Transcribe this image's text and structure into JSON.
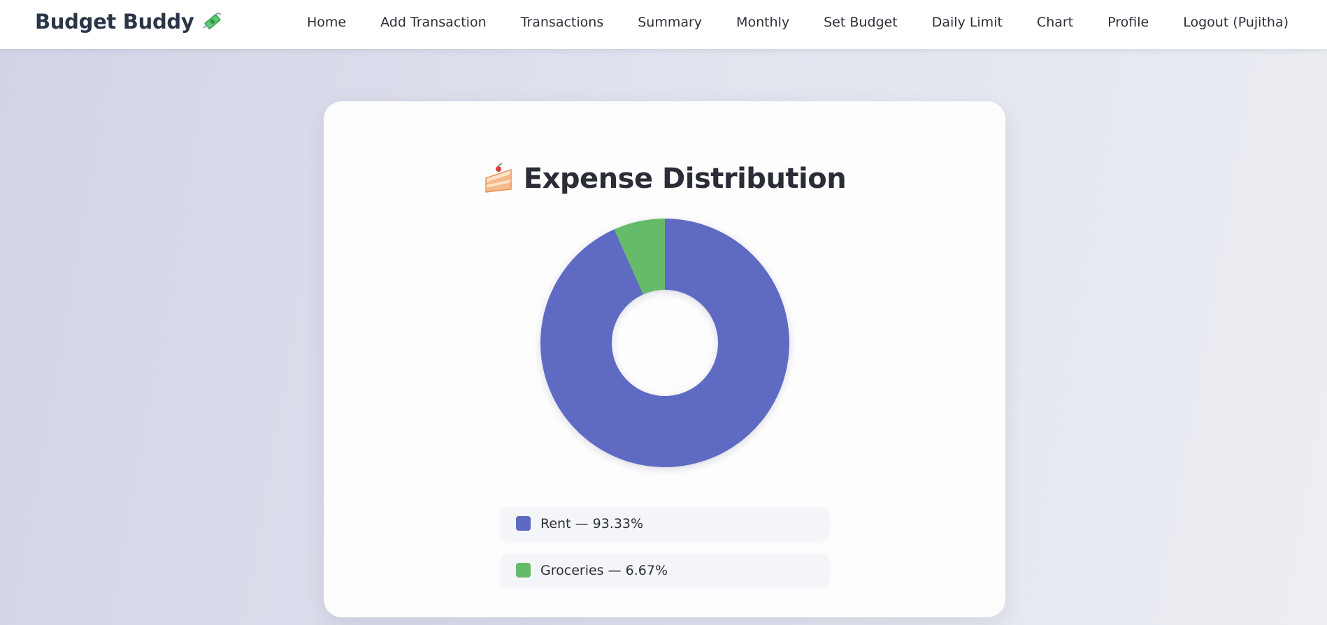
{
  "brand": {
    "name": "Budget Buddy",
    "icon": "money-with-wings-icon"
  },
  "nav": {
    "items": [
      {
        "label": "Home"
      },
      {
        "label": "Add Transaction"
      },
      {
        "label": "Transactions"
      },
      {
        "label": "Summary"
      },
      {
        "label": "Monthly"
      },
      {
        "label": "Set Budget"
      },
      {
        "label": "Daily Limit"
      },
      {
        "label": "Chart"
      },
      {
        "label": "Profile"
      },
      {
        "label": "Logout (Pujitha)"
      }
    ]
  },
  "card": {
    "title": "Expense Distribution",
    "title_icon": "cake-slice-icon"
  },
  "legend": [
    {
      "text": "Rent — 93.33%",
      "color": "#5e6ac2"
    },
    {
      "text": "Groceries — 6.67%",
      "color": "#66bb6a"
    }
  ],
  "chart_data": {
    "type": "pie",
    "variant": "doughnut",
    "title": "",
    "categories": [
      "Rent",
      "Groceries"
    ],
    "values": [
      93.33,
      6.67
    ],
    "colors": [
      "#5e6ac2",
      "#66bb6a"
    ],
    "legend_position": "bottom"
  }
}
